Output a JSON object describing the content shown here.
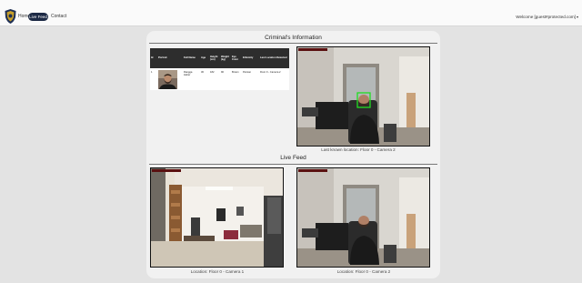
{
  "navbar": {
    "links": [
      "Home",
      "Live Feed",
      "Contact"
    ],
    "active": "Live Feed",
    "user_menu": "Welcome [guest#protected.com]"
  },
  "criminal_info": {
    "title": "Criminal's Information",
    "columns": [
      "Id",
      "Portrait",
      "Full Name",
      "Age",
      "Height (cm)",
      "Weight (kg)",
      "Eye Color",
      "Ethnicity",
      "Last Location Detected"
    ],
    "row": {
      "id": "1",
      "full_name": "Rangga Heber",
      "age": "30",
      "height": "182",
      "weight": "90",
      "eye_color": "Brown",
      "ethnicity": "Persian",
      "last_location": "Floor 0 - Camera 2"
    },
    "last_known_location": "Last known location: Floor 0 - Camera 2"
  },
  "live_feed": {
    "title": "Live Feed",
    "cameras": [
      {
        "caption": "Location: Floor 0 - Camera 1"
      },
      {
        "caption": "Location: Floor 0 - Camera 2"
      }
    ]
  },
  "colors": {
    "nav_active": "#1d2a45",
    "table_header": "#2d2d2d",
    "detection_box": "#22dd22"
  }
}
